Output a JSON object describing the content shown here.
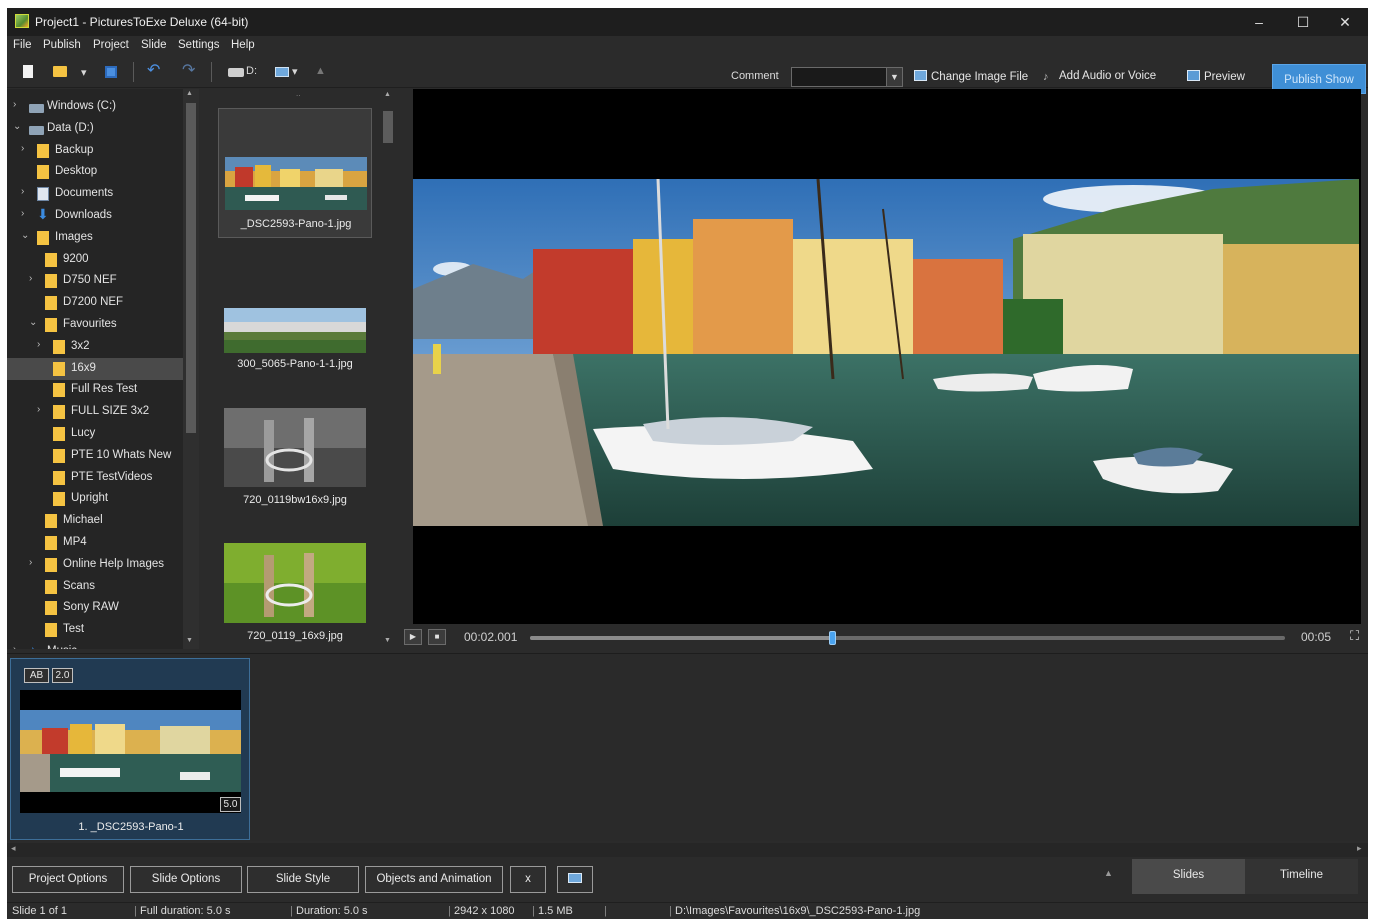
{
  "window": {
    "title": "Project1 - PicturesToExe Deluxe (64-bit)",
    "controls": [
      "–",
      "☐",
      "✕"
    ]
  },
  "menu": [
    "File",
    "Publish",
    "Project",
    "Slide",
    "Settings",
    "Help"
  ],
  "toolbar": {
    "drive_label": "D:",
    "comment_label": "Comment",
    "comment_value": "",
    "change_image": "Change Image File",
    "add_audio": "Add Audio or Voice",
    "preview": "Preview",
    "publish": "Publish Show"
  },
  "tree": {
    "items": [
      {
        "label": "Windows (C:)",
        "icon": "drive-icon",
        "arrow": ">",
        "selected": false
      },
      {
        "label": "Data (D:)",
        "icon": "drive-icon",
        "arrow": "v",
        "selected": false
      },
      {
        "label": "Backup",
        "icon": "folder-icon",
        "arrow": ">",
        "selected": false
      },
      {
        "label": "Desktop",
        "icon": "folder-icon",
        "arrow": "",
        "selected": false
      },
      {
        "label": "Documents",
        "icon": "documents-icon",
        "arrow": ">",
        "selected": false
      },
      {
        "label": "Downloads",
        "icon": "download-icon",
        "arrow": ">",
        "selected": false
      },
      {
        "label": "Images",
        "icon": "folder-icon",
        "arrow": "v",
        "selected": false
      },
      {
        "label": "9200",
        "icon": "folder-icon",
        "arrow": "",
        "selected": false
      },
      {
        "label": "D750 NEF",
        "icon": "folder-icon",
        "arrow": ">",
        "selected": false
      },
      {
        "label": "D7200 NEF",
        "icon": "folder-icon",
        "arrow": "",
        "selected": false
      },
      {
        "label": "Favourites",
        "icon": "folder-icon",
        "arrow": "v",
        "selected": false
      },
      {
        "label": "3x2",
        "icon": "folder-icon",
        "arrow": ">",
        "selected": false
      },
      {
        "label": "16x9",
        "icon": "folder-icon",
        "arrow": "",
        "selected": true
      },
      {
        "label": "Full Res Test",
        "icon": "folder-icon",
        "arrow": "",
        "selected": false
      },
      {
        "label": "FULL SIZE 3x2",
        "icon": "folder-icon",
        "arrow": ">",
        "selected": false
      },
      {
        "label": "Lucy",
        "icon": "folder-icon",
        "arrow": "",
        "selected": false
      },
      {
        "label": "PTE 10 Whats New",
        "icon": "folder-icon",
        "arrow": "",
        "selected": false
      },
      {
        "label": "PTE TestVideos",
        "icon": "folder-icon",
        "arrow": "",
        "selected": false
      },
      {
        "label": "Upright",
        "icon": "folder-icon",
        "arrow": "",
        "selected": false
      },
      {
        "label": "Michael",
        "icon": "folder-icon",
        "arrow": "",
        "selected": false
      },
      {
        "label": "MP4",
        "icon": "folder-icon",
        "arrow": "",
        "selected": false
      },
      {
        "label": "Online Help Images",
        "icon": "folder-icon",
        "arrow": ">",
        "selected": false
      },
      {
        "label": "Scans",
        "icon": "folder-icon",
        "arrow": "",
        "selected": false
      },
      {
        "label": "Sony RAW",
        "icon": "folder-icon",
        "arrow": "",
        "selected": false
      },
      {
        "label": "Test",
        "icon": "folder-icon",
        "arrow": "",
        "selected": false
      },
      {
        "label": "Music",
        "icon": "music-icon",
        "arrow": ">",
        "selected": false
      }
    ]
  },
  "files": [
    {
      "name": "_DSC2593-Pano-1.jpg",
      "selected": true
    },
    {
      "name": "300_5065-Pano-1-1.jpg",
      "selected": false
    },
    {
      "name": "720_0119bw16x9.jpg",
      "selected": false
    },
    {
      "name": "720_0119_16x9.jpg",
      "selected": false
    }
  ],
  "playback": {
    "current_time": "00:02.001",
    "end_time": "00:05",
    "progress": 0.4
  },
  "slides": [
    {
      "caption": "1. _DSC2593-Pano-1",
      "badge_ab": "AB",
      "badge_transition": "2.0",
      "duration": "5.0"
    }
  ],
  "bottom_buttons": {
    "project_options": "Project Options",
    "slide_options": "Slide Options",
    "slide_style": "Slide Style",
    "objects_animation": "Objects and Animation",
    "x": "x"
  },
  "tabs": {
    "slides": "Slides",
    "timeline": "Timeline"
  },
  "status": {
    "slide": "Slide 1 of 1",
    "full_duration": "Full duration: 5.0 s",
    "duration": "Duration: 5.0 s",
    "resolution": "2942 x 1080",
    "size": "1.5 MB",
    "path": "D:\\Images\\Favourites\\16x9\\_DSC2593-Pano-1.jpg"
  },
  "colors": {
    "accent": "#3f8fd6",
    "folder": "#f5c342",
    "background": "#2b2b2b"
  }
}
